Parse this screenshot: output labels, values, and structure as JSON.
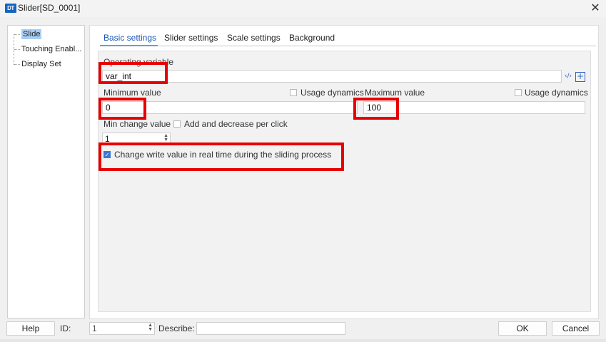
{
  "window": {
    "title": "Slider[SD_0001]",
    "icon_text": "DT",
    "close_glyph": "✕"
  },
  "tree": {
    "items": [
      {
        "label": "Slide",
        "selected": true
      },
      {
        "label": "Touching Enabl...",
        "selected": false
      },
      {
        "label": "Display Set",
        "selected": false
      }
    ]
  },
  "tabs": [
    {
      "label": "Basic settings",
      "active": true
    },
    {
      "label": "Slider settings",
      "active": false
    },
    {
      "label": "Scale settings",
      "active": false
    },
    {
      "label": "Background",
      "active": false
    }
  ],
  "basic": {
    "operating_variable_label": "Operating variable",
    "operating_variable_value": "var_int",
    "code_icon": "‹/›",
    "plus_icon": "+",
    "minimum_label": "Minimum value",
    "minimum_value": "0",
    "min_usage_dynamics_label": "Usage dynamics",
    "maximum_label": "Maximum value",
    "maximum_value": "100",
    "max_usage_dynamics_label": "Usage dynamics",
    "min_change_label": "Min change value",
    "add_decrease_label": "Add and decrease per click",
    "min_change_value": "1",
    "realtime_label": "Change write value in real time during the sliding process",
    "realtime_checked": true
  },
  "bottom": {
    "help_label": "Help",
    "id_label": "ID:",
    "id_value": "1",
    "describe_label": "Describe:",
    "describe_value": "",
    "ok_label": "OK",
    "cancel_label": "Cancel"
  },
  "colors": {
    "accent": "#3c78d0",
    "highlight_box": "#e80000",
    "tree_selected": "#a6cff5"
  }
}
